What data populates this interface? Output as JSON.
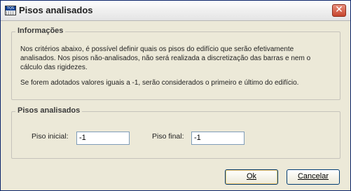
{
  "window": {
    "title": "Pisos analisados",
    "icon_label": "TQS",
    "close_symbol": "✕"
  },
  "info_group": {
    "title": "Informações",
    "paragraph1": "Nos critérios abaixo, é possível definir quais os pisos do edifício que serão efetivamente analisados. Nos pisos não-analisados, não será realizada a discretização das barras e nem o cálculo das rigidezes.",
    "paragraph2": "Se forem adotados valores iguais a -1, serão considerados o primeiro e último do edifício."
  },
  "floors_group": {
    "title": "Pisos analisados",
    "start_label": "Piso inicial:",
    "start_value": "-1",
    "end_label": "Piso final:",
    "end_value": "-1"
  },
  "buttons": {
    "ok": "Ok",
    "cancel": "Cancelar"
  }
}
